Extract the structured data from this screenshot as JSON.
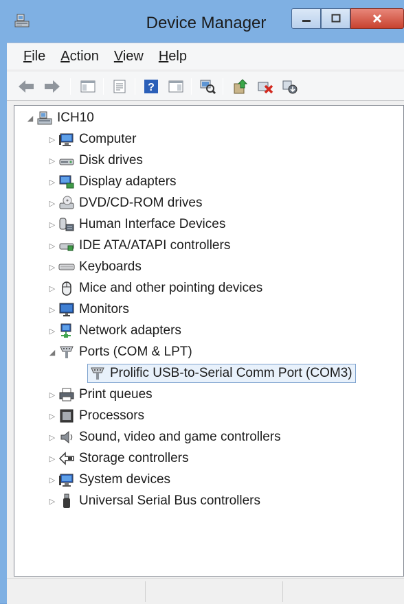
{
  "window": {
    "title": "Device Manager",
    "icon": "device-manager-icon",
    "accent": "#7fb0e3",
    "close_color": "#c8422f"
  },
  "menu": {
    "file": {
      "key": "F",
      "rest": "ile"
    },
    "action": {
      "key": "A",
      "rest": "ction"
    },
    "view": {
      "key": "V",
      "rest": "iew"
    },
    "help": {
      "key": "H",
      "rest": "elp"
    }
  },
  "toolbar": {
    "buttons": [
      "back-arrow-icon",
      "forward-arrow-icon",
      "show-hide-console-tree-icon",
      "properties-icon",
      "help-icon",
      "show-action-pane-icon",
      "scan-hardware-changes-icon",
      "update-driver-icon",
      "uninstall-device-icon",
      "disable-device-icon"
    ]
  },
  "tree": {
    "root": {
      "label": "ICH10",
      "icon": "computer-root-icon",
      "expanded": true
    },
    "items": [
      {
        "label": "Computer",
        "icon": "computer-icon",
        "expanded": false
      },
      {
        "label": "Disk drives",
        "icon": "disk-drive-icon",
        "expanded": false
      },
      {
        "label": "Display adapters",
        "icon": "display-adapter-icon",
        "expanded": false
      },
      {
        "label": "DVD/CD-ROM drives",
        "icon": "dvd-drive-icon",
        "expanded": false
      },
      {
        "label": "Human Interface Devices",
        "icon": "hid-icon",
        "expanded": false
      },
      {
        "label": "IDE ATA/ATAPI controllers",
        "icon": "ide-controller-icon",
        "expanded": false
      },
      {
        "label": "Keyboards",
        "icon": "keyboard-icon",
        "expanded": false
      },
      {
        "label": "Mice and other pointing devices",
        "icon": "mouse-icon",
        "expanded": false
      },
      {
        "label": "Monitors",
        "icon": "monitor-icon",
        "expanded": false
      },
      {
        "label": "Network adapters",
        "icon": "network-adapter-icon",
        "expanded": false
      },
      {
        "label": "Ports (COM & LPT)",
        "icon": "port-icon",
        "expanded": true
      },
      {
        "label": "Prolific USB-to-Serial Comm Port (COM3)",
        "icon": "serial-port-icon",
        "selected": true
      },
      {
        "label": "Print queues",
        "icon": "printer-icon",
        "expanded": false
      },
      {
        "label": "Processors",
        "icon": "processor-icon",
        "expanded": false
      },
      {
        "label": "Sound, video and game controllers",
        "icon": "speaker-icon",
        "expanded": false
      },
      {
        "label": "Storage controllers",
        "icon": "storage-controller-icon",
        "expanded": false
      },
      {
        "label": "System devices",
        "icon": "system-device-icon",
        "expanded": false
      },
      {
        "label": "Universal Serial Bus controllers",
        "icon": "usb-icon",
        "expanded": false
      }
    ]
  }
}
